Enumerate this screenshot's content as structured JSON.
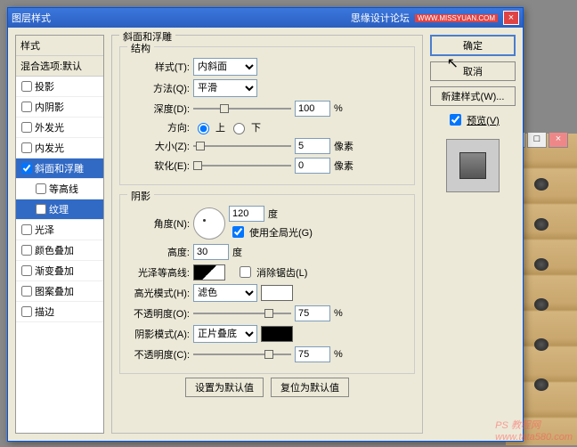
{
  "titlebar": {
    "title": "图层样式",
    "brand": "思缘设计论坛",
    "brand_url": "WWW.MISSYUAN.COM"
  },
  "left": {
    "header1": "样式",
    "header2": "混合选项:默认",
    "items": [
      {
        "label": "投影",
        "checked": false,
        "selected": false
      },
      {
        "label": "内阴影",
        "checked": false,
        "selected": false
      },
      {
        "label": "外发光",
        "checked": false,
        "selected": false
      },
      {
        "label": "内发光",
        "checked": false,
        "selected": false
      },
      {
        "label": "斜面和浮雕",
        "checked": true,
        "selected": true
      },
      {
        "label": "等高线",
        "checked": false,
        "selected": false,
        "sub": true
      },
      {
        "label": "纹理",
        "checked": false,
        "selected": true,
        "sub": true
      },
      {
        "label": "光泽",
        "checked": false,
        "selected": false
      },
      {
        "label": "颜色叠加",
        "checked": false,
        "selected": false
      },
      {
        "label": "渐变叠加",
        "checked": false,
        "selected": false
      },
      {
        "label": "图案叠加",
        "checked": false,
        "selected": false
      },
      {
        "label": "描边",
        "checked": false,
        "selected": false
      }
    ]
  },
  "center": {
    "group_title": "斜面和浮雕",
    "structure": {
      "legend": "结构",
      "style_label": "样式(T):",
      "style_value": "内斜面",
      "method_label": "方法(Q):",
      "method_value": "平滑",
      "depth_label": "深度(D):",
      "depth_value": "100",
      "depth_unit": "%",
      "direction_label": "方向:",
      "up": "上",
      "down": "下",
      "size_label": "大小(Z):",
      "size_value": "5",
      "size_unit": "像素",
      "soften_label": "软化(E):",
      "soften_value": "0",
      "soften_unit": "像素"
    },
    "shading": {
      "legend": "阴影",
      "angle_label": "角度(N):",
      "angle_value": "120",
      "angle_unit": "度",
      "global_light": "使用全局光(G)",
      "altitude_label": "高度:",
      "altitude_value": "30",
      "altitude_unit": "度",
      "gloss_label": "光泽等高线:",
      "antialias": "消除锯齿(L)",
      "highlight_mode_label": "高光模式(H):",
      "highlight_mode_value": "滤色",
      "highlight_opacity_label": "不透明度(O):",
      "highlight_opacity_value": "75",
      "opacity_unit": "%",
      "shadow_mode_label": "阴影模式(A):",
      "shadow_mode_value": "正片叠底",
      "shadow_opacity_label": "不透明度(C):",
      "shadow_opacity_value": "75"
    },
    "set_default": "设置为默认值",
    "reset_default": "复位为默认值"
  },
  "right": {
    "ok": "确定",
    "cancel": "取消",
    "new_style": "新建样式(W)...",
    "preview": "预览(V)"
  },
  "watermark": {
    "line1": "PS 教程网",
    "line2": "www.tata580.com"
  }
}
